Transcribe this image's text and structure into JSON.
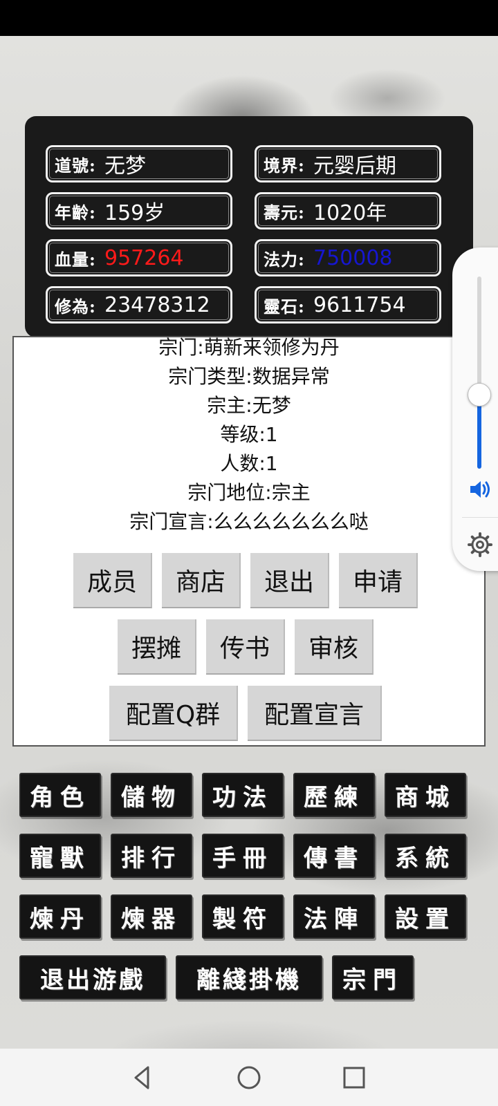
{
  "stats": [
    {
      "label": "道號:",
      "value": "无梦"
    },
    {
      "label": "境界:",
      "value": "元婴后期"
    },
    {
      "label": "年齡:",
      "value": "159岁"
    },
    {
      "label": "壽元:",
      "value": "1020年"
    },
    {
      "label": "血量:",
      "value": "957264",
      "color": "#ff1a1a"
    },
    {
      "label": "法力:",
      "value": "750008",
      "color": "#1616d0"
    },
    {
      "label": "修為:",
      "value": "23478312"
    },
    {
      "label": "靈石:",
      "value": "9611754"
    }
  ],
  "sect": {
    "lines": [
      "宗门:萌新来领修为丹",
      "宗门类型:数据异常",
      "宗主:无梦",
      "等级:1",
      "人数:1",
      "宗门地位:宗主",
      "宗门宣言:么么么么么么么哒"
    ],
    "buttons": [
      "成员",
      "商店",
      "退出",
      "申请",
      "摆摊",
      "传书",
      "审核",
      "配置Q群",
      "配置宣言"
    ]
  },
  "menu": [
    "角色",
    "儲物",
    "功法",
    "歷練",
    "商城",
    "寵獸",
    "排行",
    "手冊",
    "傳書",
    "系統",
    "煉丹",
    "煉器",
    "製符",
    "法陣",
    "設置",
    "退出游戲",
    "離綫掛機",
    "宗門"
  ],
  "volume": {
    "level_percent": 39,
    "accent": "#1565e0",
    "speaker_icon": "speaker-icon",
    "settings_icon": "gear-icon"
  },
  "navbar": {
    "back_icon": "back-triangle-icon",
    "home_icon": "home-circle-icon",
    "recents_icon": "recents-square-icon"
  }
}
